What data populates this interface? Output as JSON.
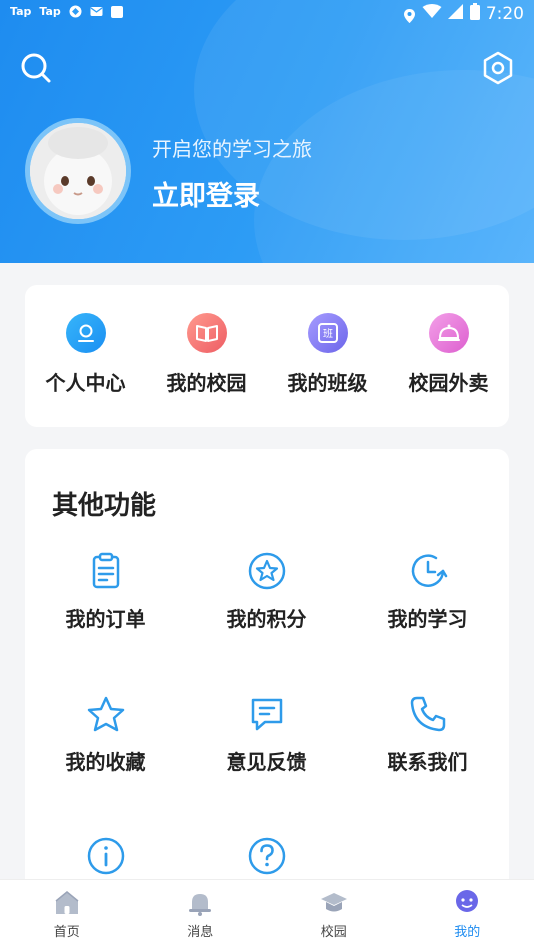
{
  "status_bar": {
    "app1": "Tap",
    "app2": "Tap",
    "time": "7:20"
  },
  "header": {
    "greeting": "开启您的学习之旅",
    "login_label": "立即登录",
    "search_icon": "search-icon",
    "settings_icon": "hexagon-settings-icon"
  },
  "quick_actions": [
    {
      "label": "个人中心",
      "icon": "user-center-icon",
      "color": "#2196f3"
    },
    {
      "label": "我的校园",
      "icon": "book-icon",
      "color": "#f06b6b"
    },
    {
      "label": "我的班级",
      "icon": "class-icon",
      "color": "#7b6ff0"
    },
    {
      "label": "校园外卖",
      "icon": "cloche-icon",
      "color": "#e56fd6"
    }
  ],
  "other": {
    "title": "其他功能",
    "items": [
      {
        "label": "我的订单",
        "icon": "order-icon"
      },
      {
        "label": "我的积分",
        "icon": "points-icon"
      },
      {
        "label": "我的学习",
        "icon": "study-icon"
      },
      {
        "label": "我的收藏",
        "icon": "star-icon"
      },
      {
        "label": "意见反馈",
        "icon": "feedback-icon"
      },
      {
        "label": "联系我们",
        "icon": "phone-icon"
      },
      {
        "label": "",
        "icon": "info-icon"
      },
      {
        "label": "",
        "icon": "help-icon"
      }
    ]
  },
  "tabbar": [
    {
      "label": "首页",
      "icon": "home-icon"
    },
    {
      "label": "消息",
      "icon": "bell-icon"
    },
    {
      "label": "校园",
      "icon": "campus-icon"
    },
    {
      "label": "我的",
      "icon": "profile-icon"
    }
  ],
  "colors": {
    "primary": "#1e8cf0",
    "icon_blue": "#2e9bea"
  }
}
